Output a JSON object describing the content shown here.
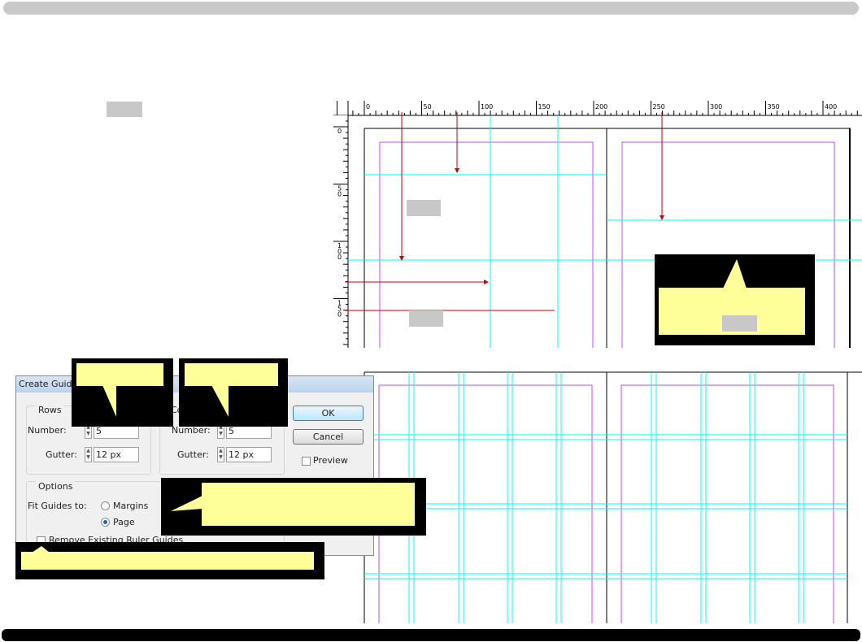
{
  "colors": {
    "callout_fill": "#ffff99",
    "callout_border": "#000000",
    "guide": "#00ffff",
    "margin_guide": "#cc44ff",
    "arrow": "#cc0000",
    "placeholder": "#c8c8c8"
  },
  "ruler": {
    "h_labels": [
      "0",
      "50",
      "100",
      "150",
      "200",
      "250",
      "300",
      "350",
      "400"
    ],
    "v_labels": [
      "0",
      "50",
      "100",
      "150"
    ]
  },
  "dialog": {
    "title": "Create Guide",
    "rows": {
      "label": "Rows",
      "number_label": "Number:",
      "number_value": "5",
      "gutter_label": "Gutter:",
      "gutter_value": "12 px"
    },
    "columns": {
      "label": "Co",
      "number_label": "Number:",
      "number_value": "5",
      "gutter_label": "Gutter:",
      "gutter_value": "12 px"
    },
    "ok_label": "OK",
    "cancel_label": "Cancel",
    "preview_label": "Preview",
    "options": {
      "label": "Options",
      "fit_label": "Fit Guides to:",
      "margins_label": "Margins",
      "page_label": "Page",
      "selected": "Page",
      "remove_label": "Remove Existing Ruler Guides"
    }
  }
}
